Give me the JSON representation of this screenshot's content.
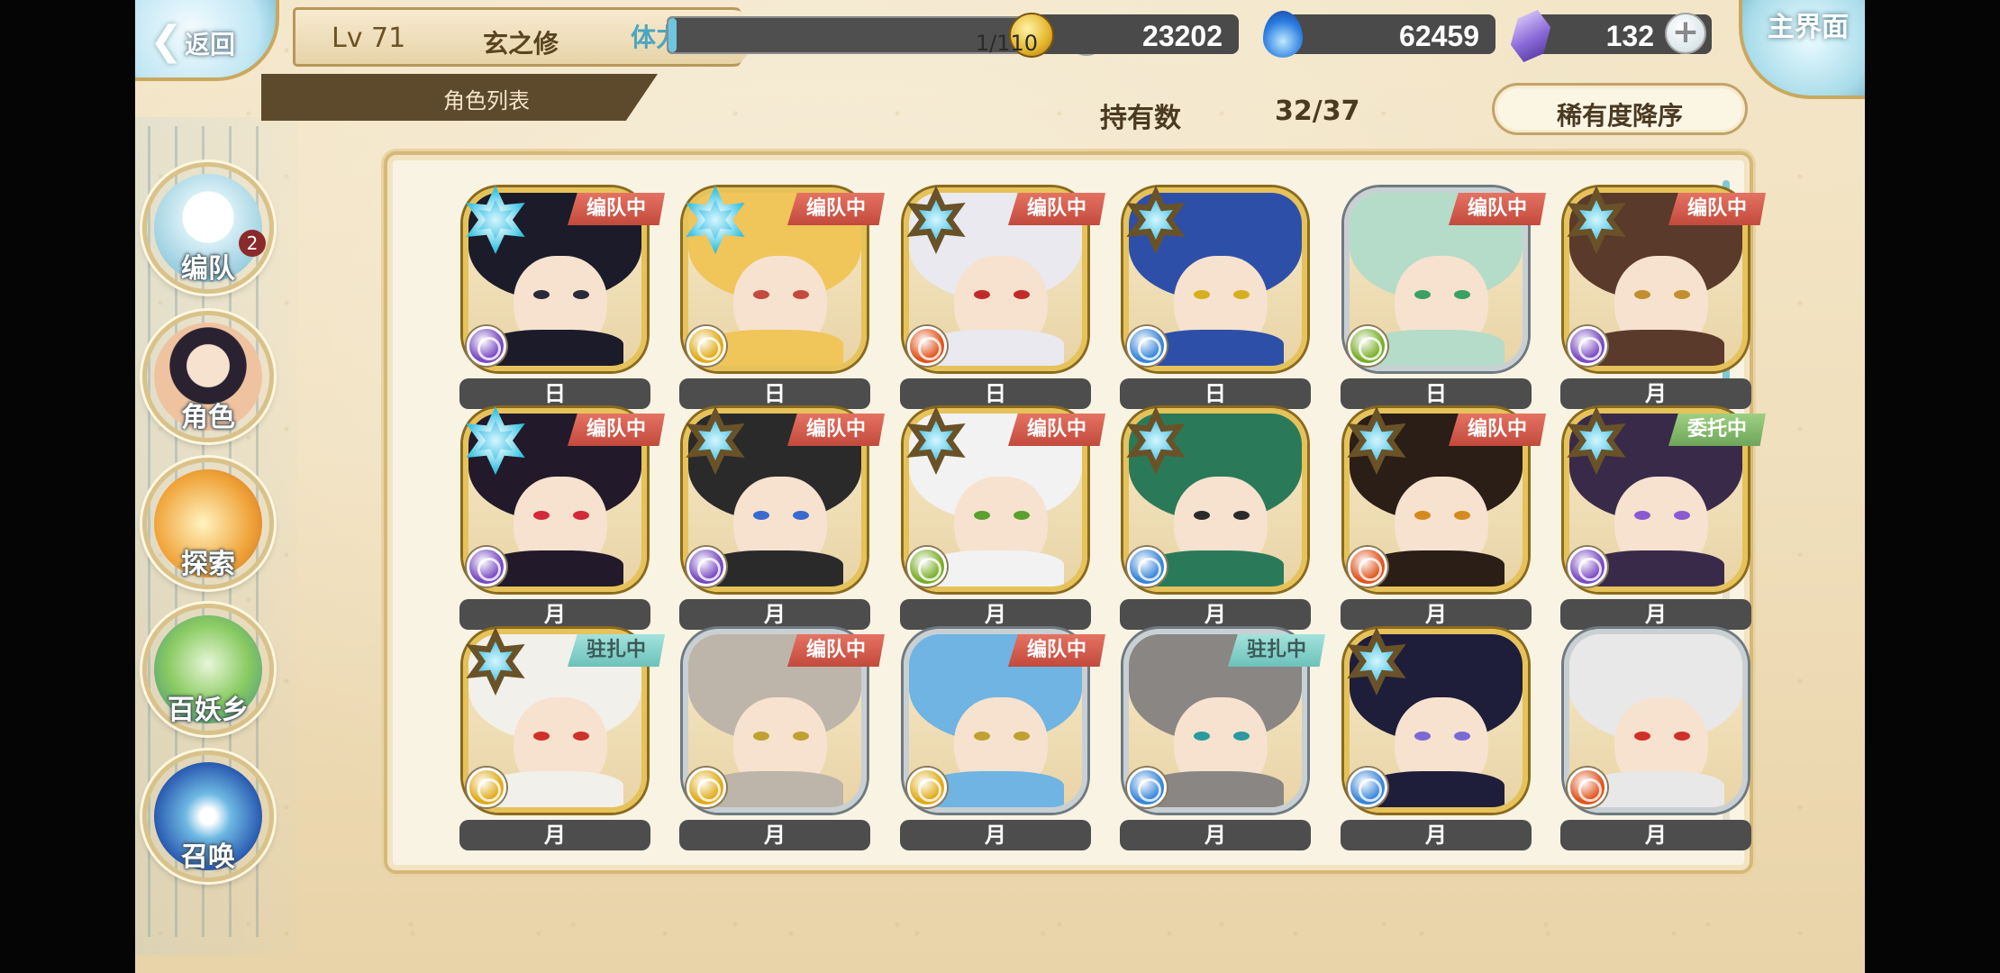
{
  "header": {
    "back_label": "返回",
    "level": "Lv 71",
    "player_name": "玄之修",
    "list_title": "角色列表",
    "stamina_label": "体力",
    "stamina_value": "1/110",
    "stamina_fraction": 0.009,
    "plus_symbol": "+",
    "gold": "23202",
    "spirit": "62459",
    "gems": "132",
    "home_label": "主界面"
  },
  "holdings": {
    "label": "持有数",
    "value": "32/37"
  },
  "sort": {
    "label": "稀有度降序"
  },
  "nav": [
    {
      "label": "编队",
      "icon": "formation-icon",
      "badge": "2"
    },
    {
      "label": "角色",
      "icon": "character-icon"
    },
    {
      "label": "探索",
      "icon": "explore-icon"
    },
    {
      "label": "百妖乡",
      "icon": "village-icon"
    },
    {
      "label": "召唤",
      "icon": "summon-icon"
    }
  ],
  "cards": [
    {
      "tag": "编队中",
      "tag_color": "red",
      "star": "blue",
      "element": "purple",
      "element_color": "#7a4bc2",
      "hair": "#1b1b2a",
      "eye": "#2a2a3a",
      "day": "日"
    },
    {
      "tag": "编队中",
      "tag_color": "red",
      "star": "blue",
      "element": "yellow",
      "element_color": "#e0ab1a",
      "hair": "#f0c55a",
      "eye": "#c24a3c",
      "day": "日"
    },
    {
      "tag": "编队中",
      "tag_color": "red",
      "star": "brown",
      "element": "orange",
      "element_color": "#e0551f",
      "hair": "#e9e9ef",
      "eye": "#c22a2a",
      "day": "日"
    },
    {
      "tag": "",
      "tag_color": "",
      "star": "brown",
      "element": "blue",
      "element_color": "#3a86d8",
      "hair": "#2e4fa8",
      "eye": "#d4b020",
      "day": "日"
    },
    {
      "tag": "编队中",
      "tag_color": "red",
      "star": "",
      "element": "green",
      "element_color": "#7aae2a",
      "hair": "#b4dcc8",
      "eye": "#3aa064",
      "day": "日"
    },
    {
      "tag": "编队中",
      "tag_color": "red",
      "star": "brown",
      "element": "purple",
      "element_color": "#7a4bc2",
      "hair": "#5a3a2a",
      "eye": "#c09030",
      "day": "月"
    },
    {
      "tag": "编队中",
      "tag_color": "red",
      "star": "blue",
      "element": "purple",
      "element_color": "#7a4bc2",
      "hair": "#221a2a",
      "eye": "#d22a3a",
      "day": "月"
    },
    {
      "tag": "编队中",
      "tag_color": "red",
      "star": "brown",
      "element": "purple",
      "element_color": "#7a4bc2",
      "hair": "#2a2a2a",
      "eye": "#3a6ad0",
      "day": "月"
    },
    {
      "tag": "编队中",
      "tag_color": "red",
      "star": "brown",
      "element": "green",
      "element_color": "#7aae2a",
      "hair": "#f2f2f2",
      "eye": "#5aa030",
      "day": "月"
    },
    {
      "tag": "",
      "tag_color": "",
      "star": "brown",
      "element": "blue",
      "element_color": "#3a86d8",
      "hair": "#2a7a5a",
      "eye": "#2a2a2a",
      "day": "月"
    },
    {
      "tag": "编队中",
      "tag_color": "red",
      "star": "brown",
      "element": "orange",
      "element_color": "#e0551f",
      "hair": "#2a1e16",
      "eye": "#d48a20",
      "day": "月"
    },
    {
      "tag": "委托中",
      "tag_color": "green",
      "star": "brown",
      "element": "purple",
      "element_color": "#7a4bc2",
      "hair": "#3a2a4a",
      "eye": "#8a5ad0",
      "day": "月"
    },
    {
      "tag": "驻扎中",
      "tag_color": "teal",
      "star": "brown",
      "element": "yellow",
      "element_color": "#e0ab1a",
      "hair": "#f2f0ea",
      "eye": "#d0302a",
      "day": "月"
    },
    {
      "tag": "编队中",
      "tag_color": "red",
      "star": "",
      "element": "yellow",
      "element_color": "#e0ab1a",
      "hair": "#bdb4aa",
      "eye": "#c0a030",
      "day": "月"
    },
    {
      "tag": "编队中",
      "tag_color": "red",
      "star": "",
      "element": "yellow",
      "element_color": "#e0ab1a",
      "hair": "#6fb4e2",
      "eye": "#c0a030",
      "day": "月"
    },
    {
      "tag": "驻扎中",
      "tag_color": "teal",
      "star": "",
      "element": "blue",
      "element_color": "#3a86d8",
      "hair": "#8a8684",
      "eye": "#2a9aa0",
      "day": "月"
    },
    {
      "tag": "",
      "tag_color": "",
      "star": "brown",
      "element": "blue",
      "element_color": "#3a86d8",
      "hair": "#1e1e3a",
      "eye": "#7a6ad8",
      "day": "月"
    },
    {
      "tag": "",
      "tag_color": "",
      "star": "",
      "element": "orange",
      "element_color": "#e0551f",
      "hair": "#e8e8e8",
      "eye": "#d0302a",
      "day": "月"
    }
  ]
}
